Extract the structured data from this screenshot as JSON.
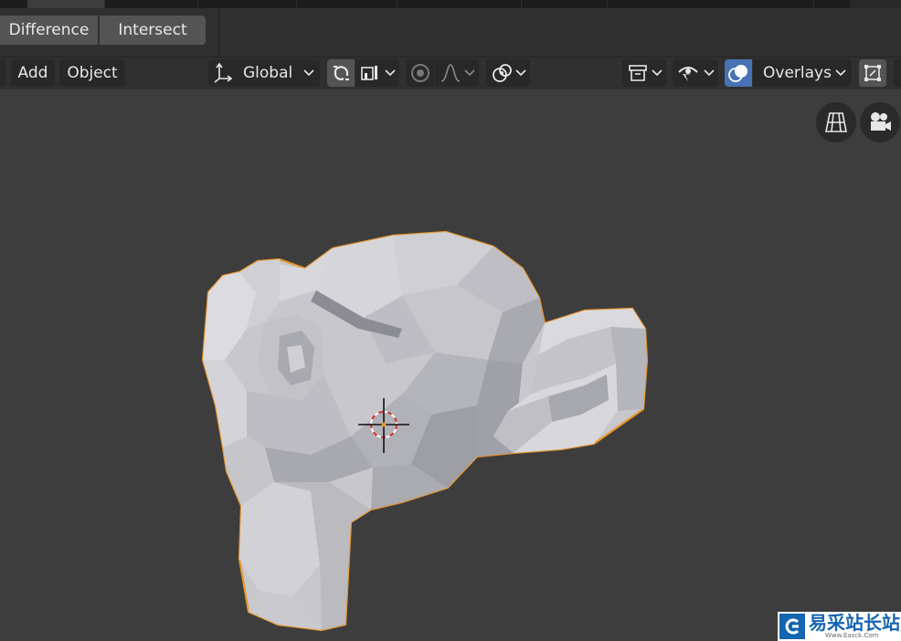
{
  "boolean_bar": {
    "difference_label": "Difference",
    "intersect_label": "Intersect"
  },
  "header": {
    "add_label": "Add",
    "object_label": "Object",
    "orientation_label": "Global",
    "overlays_label": "Overlays"
  },
  "icons": [
    "transform-axes-icon",
    "snap-magnet-icon",
    "snap-increment-icon",
    "proportional-edit-icon",
    "falloff-curve-icon",
    "pivot-point-icon",
    "object-visibility-icon",
    "selectability-icon",
    "overlays-icon",
    "gizmo-icon",
    "perspective-grid-icon",
    "camera-icon",
    "3d-cursor-icon"
  ],
  "colors": {
    "selection_outline": "#e8952a",
    "mesh": "#c8c8cc",
    "accent_active": "#4772b3",
    "viewport_bg": "#3d3d3d"
  },
  "watermark": {
    "text": "易采站长站",
    "subtext": "Www.Easck.Com"
  }
}
